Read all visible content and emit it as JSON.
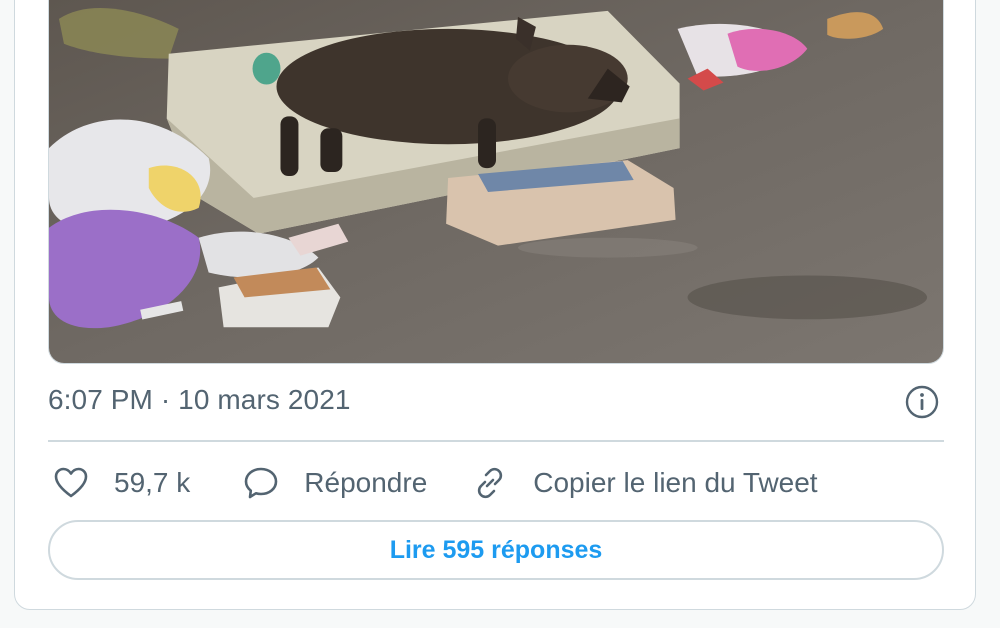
{
  "tweet": {
    "image_alt": "Sanglier couché sur un matelas au milieu de déchets",
    "timestamp": "6:07 PM · 10 mars 2021",
    "actions": {
      "like_count": "59,7 k",
      "reply_label": "Répondre",
      "copy_link_label": "Copier le lien du Tweet"
    },
    "read_replies_label": "Lire 595 réponses"
  },
  "icons": {
    "info": "info-icon",
    "like": "heart-icon",
    "reply": "speech-bubble-icon",
    "copy_link": "link-icon"
  },
  "colors": {
    "accent": "#1d9bf0",
    "text_secondary": "#536471",
    "border": "#cfd9de"
  }
}
